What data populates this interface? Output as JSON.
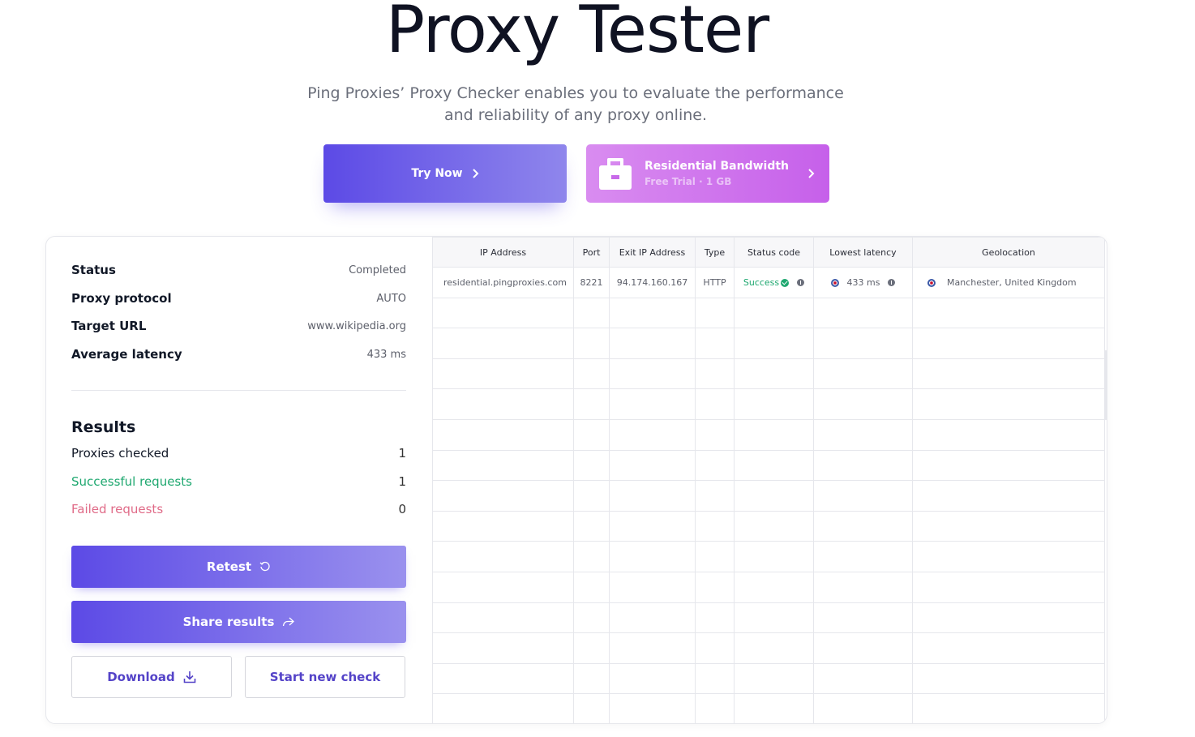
{
  "header": {
    "title": "Proxy Tester",
    "subtitle_line1": "Ping Proxies’ Proxy Checker enables you to evaluate the performance",
    "subtitle_line2": "and reliability of any proxy online."
  },
  "cta": {
    "try_now_label": "Try Now",
    "residential_title": "Residential Bandwidth",
    "residential_sub": "Free Trial · 1 GB"
  },
  "summary": {
    "rows": [
      {
        "label": "Status",
        "value": "Completed"
      },
      {
        "label": "Proxy protocol",
        "value": "AUTO"
      },
      {
        "label": "Target URL",
        "value": "www.wikipedia.org"
      },
      {
        "label": "Average latency",
        "value": "433 ms"
      }
    ]
  },
  "results": {
    "heading": "Results",
    "rows": [
      {
        "label": "Proxies checked",
        "value": "1"
      },
      {
        "label": "Successful requests",
        "value": "1"
      },
      {
        "label": "Failed requests",
        "value": "0"
      }
    ]
  },
  "actions": {
    "retest_label": "Retest",
    "share_label": "Share results",
    "download_label": "Download",
    "new_check_label": "Start new check"
  },
  "table": {
    "columns": [
      "IP Address",
      "Port",
      "Exit IP Address",
      "Type",
      "Status code",
      "Lowest latency",
      "Geolocation"
    ],
    "rows": [
      {
        "ip": "residential.pingproxies.com",
        "port": "8221",
        "exit_ip": "94.174.160.167",
        "type": "HTTP",
        "status": "Success",
        "latency": "433 ms",
        "geo": "Manchester, United Kingdom"
      }
    ]
  },
  "colors": {
    "accent": "#5c4ae6",
    "residential": "#c660ea",
    "success": "#1fa870",
    "failed": "#e06b88"
  }
}
